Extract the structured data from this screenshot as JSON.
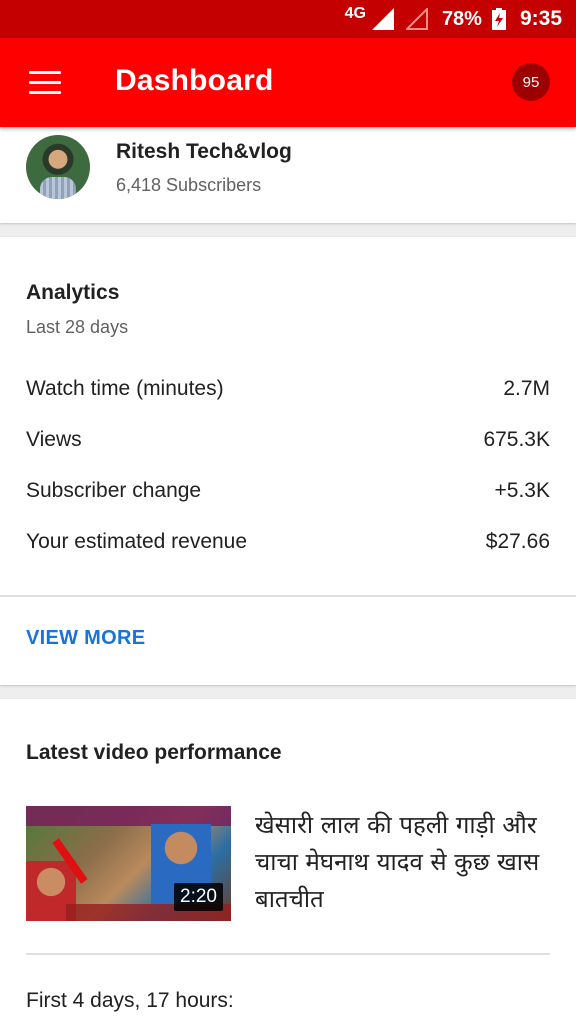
{
  "status_bar": {
    "network": "4G",
    "battery_percent": "78%",
    "time": "9:35"
  },
  "app_bar": {
    "title": "Dashboard",
    "notification_count": "95"
  },
  "channel": {
    "name": "Ritesh Tech&vlog",
    "subscribers": "6,418 Subscribers"
  },
  "analytics": {
    "title": "Analytics",
    "period": "Last 28 days",
    "metrics": [
      {
        "label": "Watch time (minutes)",
        "value": "2.7M"
      },
      {
        "label": "Views",
        "value": "675.3K"
      },
      {
        "label": "Subscriber change",
        "value": "+5.3K"
      },
      {
        "label": "Your estimated revenue",
        "value": "$27.66"
      }
    ],
    "view_more": "VIEW MORE"
  },
  "latest_video": {
    "title": "Latest video performance",
    "video_title": "खेसारी लाल की पहली गाड़ी और चाचा मेघनाथ यादव से कुछ खास बातचीत",
    "duration": "2:20",
    "first_period": "First 4 days, 17 hours:"
  }
}
